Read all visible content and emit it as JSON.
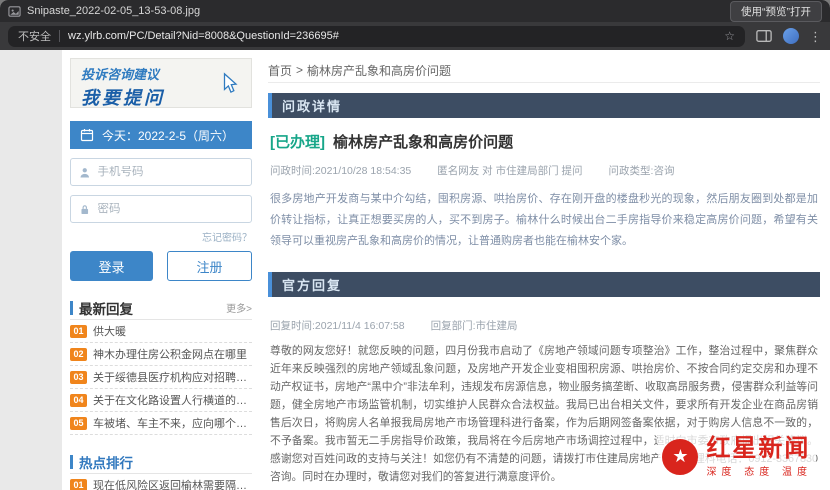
{
  "window": {
    "title": "Snipaste_2022-02-05_13-53-08.jpg",
    "open_with": "使用“预览”打开"
  },
  "browser": {
    "security": "不安全",
    "url": "wz.ylrb.com/PC/Detail?Nid=8008&QuestionId=236695#"
  },
  "icons": {
    "star": "☆",
    "star_filled": "★",
    "menu": "⋮"
  },
  "colors": {
    "accent_blue": "#3d86c8",
    "section_header_bg": "#3d4d63",
    "status_green": "#17a689",
    "rank_orange": "#f0851c",
    "brand_red": "#d9251d"
  },
  "sidebar": {
    "banner": {
      "line1": "投诉咨询建议",
      "line2": "我要提问"
    },
    "date": "今天：2022-2-5（周六）",
    "login": {
      "phone_placeholder": "手机号码",
      "password_placeholder": "密码",
      "forgot": "忘记密码？",
      "login": "登录",
      "register": "注册"
    },
    "latest": {
      "title": "最新回复",
      "more": "更多>",
      "items": [
        {
          "rank": "01",
          "text": "供大暖"
        },
        {
          "rank": "02",
          "text": "神木办理住房公积金网点在哪里"
        },
        {
          "rank": "03",
          "text": "关于绥德县医疗机构应对招聘安家费发放补..."
        },
        {
          "rank": "04",
          "text": "关于在文化路设置人行横道的建议"
        },
        {
          "rank": "05",
          "text": "车被堵、车主不来，应向哪个单位反应"
        }
      ]
    },
    "hot": {
      "title": "热点排行",
      "items": [
        {
          "rank": "01",
          "text": "现在低风险区返回榆林需要隔离吗？"
        }
      ]
    }
  },
  "main": {
    "breadcrumb": {
      "home": "首页",
      "sep": ">",
      "current": "榆林房产乱象和高房价问题"
    },
    "detail": {
      "header": "问政详情",
      "status": "[已办理]",
      "title": "榆林房产乱象和高房价问题",
      "meta_time": "问政时间:2021/10/28 18:54:35",
      "meta_asker": "匿名网友 对 市住建局部门 提问",
      "meta_type": "问政类型:咨询",
      "body": "很多房地产开发商与某中介勾结，囤积房源、哄抬房价、存在刚开盘的楼盘秒光的现象，然后朋友圈到处都是加价转让指标，让真正想要买房的人，买不到房子。榆林什么时候出台二手房指导价来稳定高房价问题，希望有关领导可以重视房产乱象和高房价的情况，让普通购房者也能在榆林安个家。"
    },
    "reply": {
      "header": "官方回复",
      "meta_time": "回复时间:2021/11/4 16:07:58",
      "meta_dept": "回复部门:市住建局",
      "body": "尊敬的网友您好！就您反映的问题，四月份我市启动了《房地产领域问题专项整治》工作，整治过程中，聚焦群众近年来反映强烈的房地产领域乱象问题，及房地产开发企业变相囤积房源、哄抬房价、不按合同约定交房和办理不动产权证书，房地产“黑中介”非法牟利，违规发布房源信息，物业服务搞垄断、收取高昂服务费，侵害群众利益等问题，健全房地产市场监管机制，切实维护人民群众合法权益。我局已出台相关文件，要求所有开发企业在商品房销售后次日，将购房人名单报我局房地产市场管理科进行备案，作为后期网签备案依据，对于购房人信息不一致的，不予备案。我市暂无二手房指导价政策，我局将在今后房地产市场调控过程中，适时向市委市政府提出相关建议。感谢您对百姓问政的支持与关注！如您仍有不清楚的问题，请拨打市住建局房地产市场管理科电话：0912-3367830咨询。同时在办理时，敬请您对我们的答复进行满意度评价。"
    },
    "watermark": {
      "brand": "红星新闻",
      "slogan": "深度 态度 温度"
    }
  }
}
